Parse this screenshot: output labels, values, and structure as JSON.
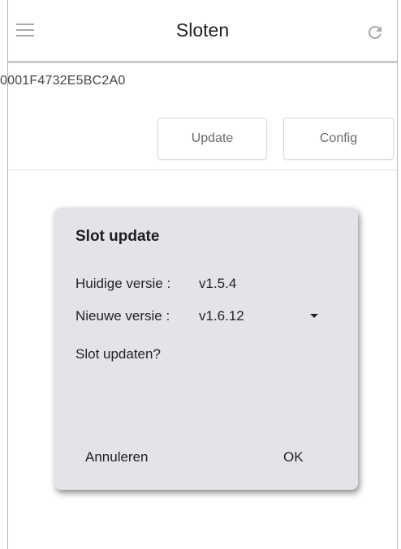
{
  "header": {
    "title": "Sloten",
    "menu_icon": "hamburger-menu-icon",
    "refresh_icon": "refresh-icon"
  },
  "device": {
    "id": "0001F4732E5BC2A0"
  },
  "actions": {
    "update_label": "Update",
    "config_label": "Config"
  },
  "dialog": {
    "title": "Slot update",
    "current_version_label": "Huidige versie :",
    "current_version_value": "v1.5.4",
    "new_version_label": "Nieuwe versie :",
    "new_version_value": "v1.6.12",
    "question": "Slot updaten?",
    "cancel_label": "Annuleren",
    "ok_label": "OK"
  },
  "colors": {
    "dialog_background": "#e4e3ea",
    "header_border": "#c9c9c9",
    "icon_grey": "#a9a9a9"
  }
}
